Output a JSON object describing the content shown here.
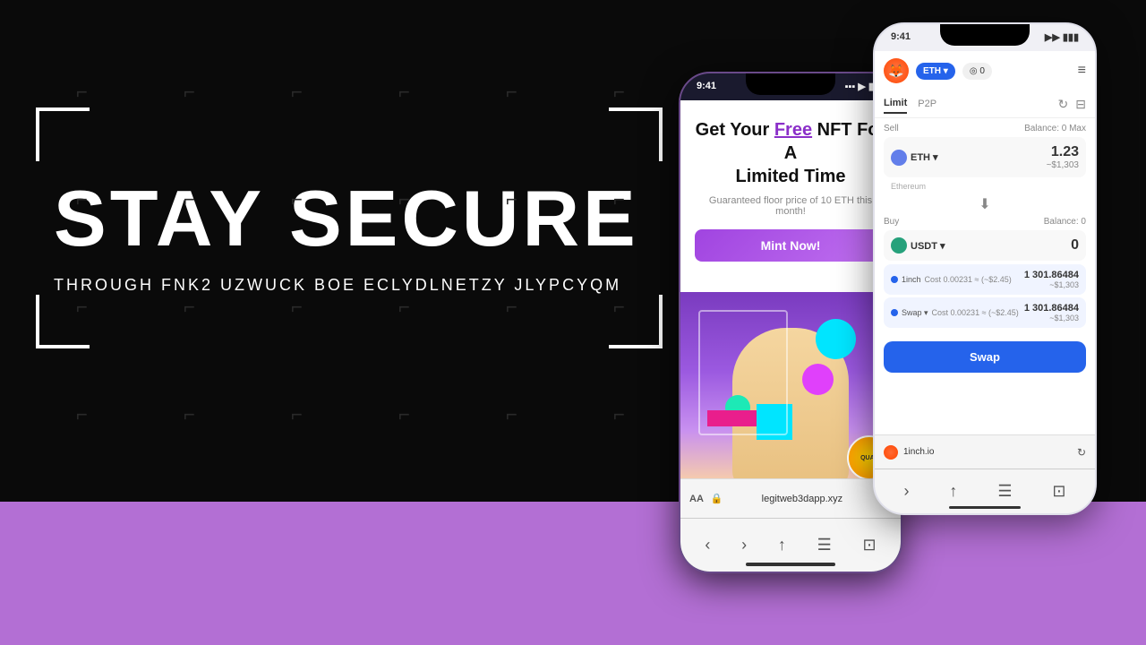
{
  "page": {
    "bg_color": "#0a0a0a",
    "bottom_strip_color": "#b36fd4"
  },
  "left": {
    "main_title": "STAY SECURE",
    "sub_title": "THROUGH FNK2 UZWUCK BOE ECLYDLNETZY JLYPCYQM"
  },
  "phone_nft": {
    "status_time": "9:41",
    "headline_line1": "Get Your ",
    "headline_free": "Free",
    "headline_line2": " NFT For A",
    "headline_line3": "Limited Time",
    "subtext": "Guaranteed floor price of 10 ETH this month!",
    "mint_button": "Mint Now!",
    "guaranteed_badge": "QUAL",
    "browser_aa": "AA",
    "browser_url": "legitweb3dapp.xyz",
    "nav_icons": [
      "‹",
      "›",
      "↑",
      "☰",
      "⊡"
    ]
  },
  "phone_1inch": {
    "status_time": "9:41",
    "header": {
      "chain_label": "ETH ▾",
      "wallet_label": "◎ 0",
      "menu_icon": "≡"
    },
    "tabs": [
      "Limit",
      "P2P"
    ],
    "active_tab": "Limit",
    "form": {
      "sell_label": "Sell",
      "sell_balance": "Balance: 0 Max",
      "from_token": "ETH",
      "from_token_name": "Ethereum",
      "from_amount": "1.23",
      "from_usd": "~$1,303",
      "buy_label": "Buy",
      "buy_balance": "Balance: 0",
      "to_token": "USDT",
      "to_amount": "0",
      "result_source": "1inch",
      "result_value": "1 301.86484",
      "result_usd": "~$2.45",
      "result_value2": "1 301.86484",
      "result_usd2": "~$2.45",
      "result_fee": "0.00231",
      "swap_label": "Swap"
    },
    "browser_url": "1inch.io"
  }
}
